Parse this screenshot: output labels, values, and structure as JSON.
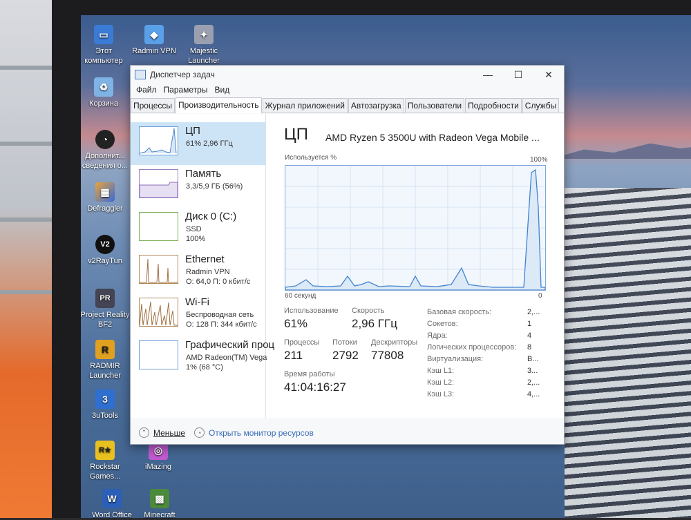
{
  "desktop_icons": [
    {
      "label": "Этот компьютер",
      "glyph": "▭",
      "color": "#3a7bd5"
    },
    {
      "label": "Radmin VPN",
      "glyph": "◆",
      "color": "#5aa0e8"
    },
    {
      "label": "Majestic Launcher",
      "glyph": "✦",
      "color": "#d8d8d8"
    },
    {
      "label": "Корзина",
      "glyph": "🗑",
      "color": "#7fb3e6"
    },
    {
      "label": "Дополнит... сведения о...",
      "glyph": "◔",
      "color": "#222"
    },
    {
      "label": "Defraggler",
      "glyph": "▦",
      "color": "#e8a33a"
    },
    {
      "label": "v2RayTun",
      "glyph": "V2",
      "color": "#111"
    },
    {
      "label": "Project Reality BF2",
      "glyph": "PR",
      "color": "#445"
    },
    {
      "label": "RADMIR Launcher",
      "glyph": "R",
      "color": "#e0a020"
    },
    {
      "label": "3uTools",
      "glyph": "3",
      "color": "#2f6fd0"
    },
    {
      "label": "Rockstar Games...",
      "glyph": "R★",
      "color": "#e8c020"
    },
    {
      "label": "iMazing",
      "glyph": "◎",
      "color": "#c05ad0"
    },
    {
      "label": "Word Office",
      "glyph": "W",
      "color": "#2b5fb8"
    },
    {
      "label": "Minecraft",
      "glyph": "▩",
      "color": "#4a8a3a"
    }
  ],
  "window": {
    "title": "Диспетчер задач",
    "minimize": "—",
    "maximize": "☐",
    "close": "✕",
    "menu": [
      "Файл",
      "Параметры",
      "Вид"
    ],
    "tabs": [
      "Процессы",
      "Производительность",
      "Журнал приложений",
      "Автозагрузка",
      "Пользователи",
      "Подробности",
      "Службы"
    ],
    "active_tab": "Производительность"
  },
  "resources": [
    {
      "title": "ЦП",
      "sub1": "61% 2,96 ГГц",
      "sub2": ""
    },
    {
      "title": "Память",
      "sub1": "3,3/5,9 ГБ (56%)",
      "sub2": ""
    },
    {
      "title": "Диск 0 (C:)",
      "sub1": "SSD",
      "sub2": "100%"
    },
    {
      "title": "Ethernet",
      "sub1": "Radmin VPN",
      "sub2": "О: 64,0 П: 0 кбит/с"
    },
    {
      "title": "Wi-Fi",
      "sub1": "Беспроводная сеть",
      "sub2": "О: 128 П: 344 кбит/с"
    },
    {
      "title": "Графический проц",
      "sub1": "AMD Radeon(TM) Vega",
      "sub2": "1% (68 °C)"
    }
  ],
  "cpu": {
    "heading": "ЦП",
    "model": "AMD Ryzen 5 3500U with Radeon Vega Mobile ...",
    "graph_label": "Используется %",
    "graph_max": "100%",
    "graph_time": "60 секунд",
    "graph_min": "0",
    "usage_label": "Использование",
    "usage": "61%",
    "speed_label": "Скорость",
    "speed": "2,96 ГГц",
    "processes_label": "Процессы",
    "processes": "211",
    "threads_label": "Потоки",
    "threads": "2792",
    "handles_label": "Дескрипторы",
    "handles": "77808",
    "uptime_label": "Время работы",
    "uptime": "41:04:16:27",
    "details": [
      {
        "k": "Базовая скорость:",
        "v": "2,..."
      },
      {
        "k": "Сокетов:",
        "v": "1"
      },
      {
        "k": "Ядра:",
        "v": "4"
      },
      {
        "k": "Логических процессоров:",
        "v": "8"
      },
      {
        "k": "Виртуализация:",
        "v": "В..."
      },
      {
        "k": "Кэш L1:",
        "v": "3..."
      },
      {
        "k": "Кэш L2:",
        "v": "2,..."
      },
      {
        "k": "Кэш L3:",
        "v": "4,..."
      }
    ]
  },
  "footer": {
    "less": "Меньше",
    "monitor": "Открыть монитор ресурсов"
  }
}
